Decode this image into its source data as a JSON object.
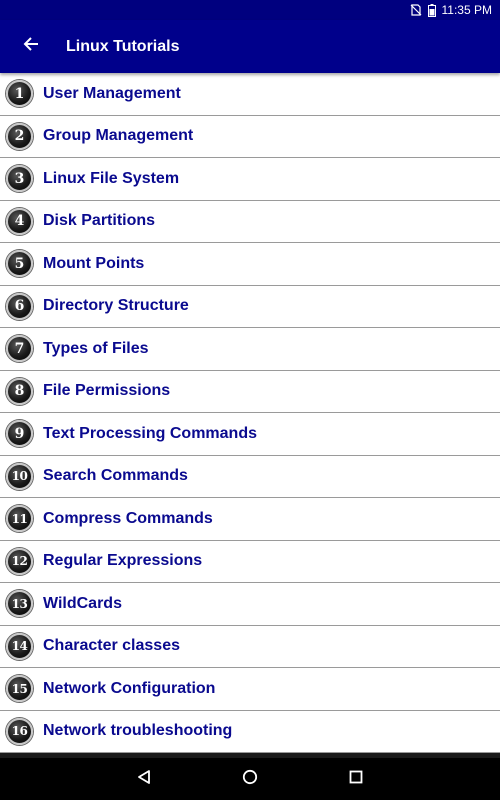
{
  "status_bar": {
    "time": "11:35 PM",
    "icons": [
      "no-sim-icon",
      "battery-icon"
    ]
  },
  "app_bar": {
    "back_icon": "arrow-left-icon",
    "title": "Linux Tutorials",
    "background": "#00008b"
  },
  "tutorials": [
    {
      "num": "1",
      "label": "User Management"
    },
    {
      "num": "2",
      "label": "Group Management"
    },
    {
      "num": "3",
      "label": "Linux File System"
    },
    {
      "num": "4",
      "label": "Disk Partitions"
    },
    {
      "num": "5",
      "label": "Mount Points"
    },
    {
      "num": "6",
      "label": "Directory Structure"
    },
    {
      "num": "7",
      "label": "Types of Files"
    },
    {
      "num": "8",
      "label": "File Permissions"
    },
    {
      "num": "9",
      "label": "Text Processing Commands"
    },
    {
      "num": "10",
      "label": "Search Commands"
    },
    {
      "num": "11",
      "label": "Compress Commands"
    },
    {
      "num": "12",
      "label": "Regular Expressions"
    },
    {
      "num": "13",
      "label": "WildCards"
    },
    {
      "num": "14",
      "label": "Character classes"
    },
    {
      "num": "15",
      "label": "Network Configuration"
    },
    {
      "num": "16",
      "label": "Network troubleshooting"
    }
  ],
  "nav_bar": {
    "buttons": [
      "back-triangle-icon",
      "home-circle-icon",
      "recents-square-icon"
    ]
  },
  "colors": {
    "label_text": "#0a0a8f",
    "divider": "#9a9a9a"
  }
}
